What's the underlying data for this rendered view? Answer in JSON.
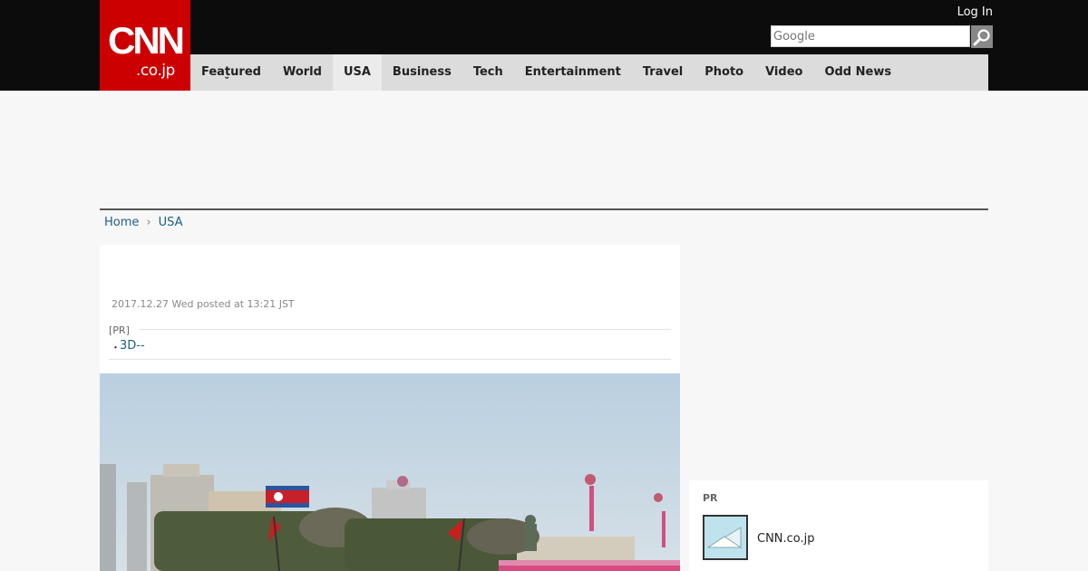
{
  "logo": {
    "main": "CNN",
    "sub": ".co.jp"
  },
  "header": {
    "login_label": "Log In",
    "search_placeholder": "Google"
  },
  "nav": {
    "items": [
      "Featured",
      "World",
      "USA",
      "Business",
      "Tech",
      "Entertainment",
      "Travel",
      "Photo",
      "Video",
      "Odd News"
    ],
    "active": "USA"
  },
  "breadcrumb": {
    "home": "Home",
    "section": "USA"
  },
  "article": {
    "posted": "2017.12.27 Wed posted at 13:21 JST",
    "pr_label": "[PR]",
    "pr_bullet": "・",
    "pr_link": "3D--"
  },
  "sidebar_pr": {
    "label": "PR",
    "link": "CNN.co.jp"
  },
  "colors": {
    "brand": "#cc0000",
    "header_bg": "#0c0c0c",
    "nav_bg": "#dcdcdc",
    "link": "#1a5e8a"
  }
}
